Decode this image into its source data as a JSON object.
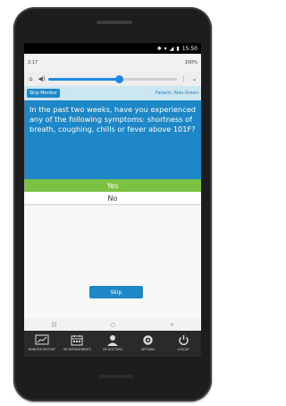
{
  "device_status": {
    "time": "15:50"
  },
  "app_status": {
    "time": "2:17",
    "battery": "100%"
  },
  "header": {
    "skip_monitor_label": "Skip Monitor",
    "patient_label": "Patient: Alex Green"
  },
  "question": {
    "text": "In the past two weeks, have you experienced any of the following symptoms: shortness of breath, coughing, chills or fever above 101F?"
  },
  "options": {
    "yes": "Yes",
    "no": "No"
  },
  "skip_button_label": "Skip",
  "volume_level": 0.55,
  "bottom_nav": [
    {
      "label": "MONITOR HISTORY",
      "icon": "chart-icon"
    },
    {
      "label": "MY APPOINTMENTS",
      "icon": "calendar-icon"
    },
    {
      "label": "MY DOCTORS",
      "icon": "doctor-icon"
    },
    {
      "label": "SETTINGS",
      "icon": "gear-icon"
    },
    {
      "label": "LOGOUT",
      "icon": "power-icon"
    }
  ],
  "colors": {
    "primary": "#1e87c7",
    "yes_green": "#7bc142",
    "header_bg": "#cce6f2"
  }
}
